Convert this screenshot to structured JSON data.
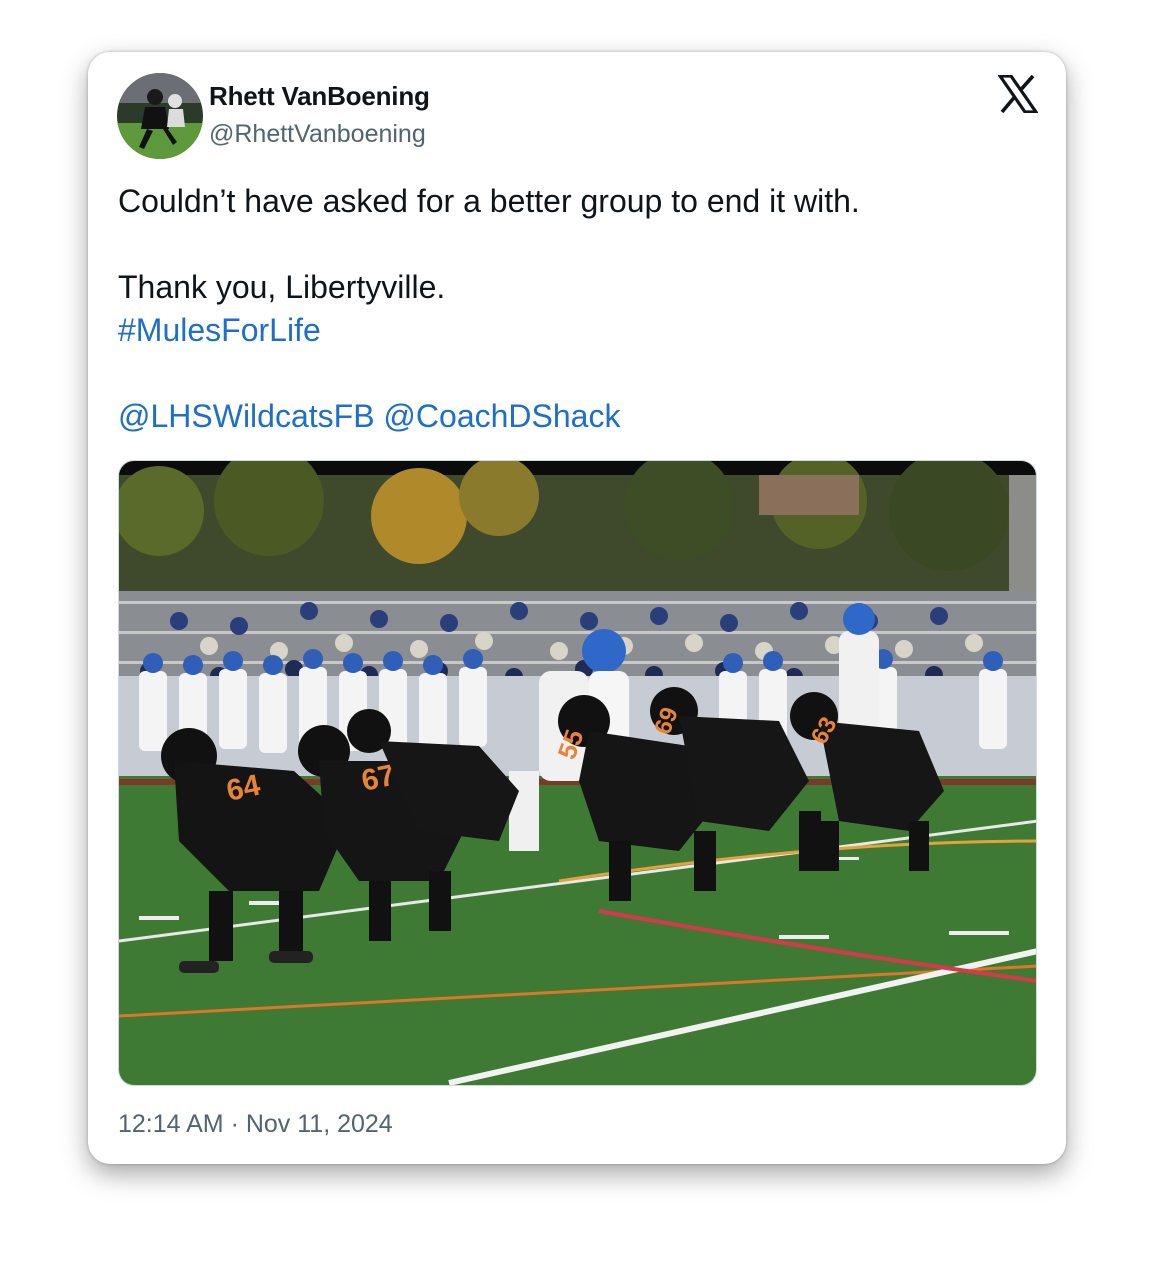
{
  "tweet": {
    "author": {
      "display_name": "Rhett VanBoening",
      "handle": "@RhettVanboening",
      "avatar_icon": "football-player-avatar"
    },
    "platform_icon": "x-logo-icon",
    "text": {
      "line1": "Couldn’t have asked for a better group to end it with.",
      "line2": "Thank you, Libertyville.",
      "hashtag": "#MulesForLife",
      "mention1": "@LHSWildcatsFB",
      "mention2": "@CoachDShack"
    },
    "timestamp": "12:14 AM · Nov 11, 2024",
    "colors": {
      "link": "#1d6fc7",
      "secondary_text": "#536471",
      "field_green": "#3f7a34",
      "jersey_orange": "#e8833a"
    },
    "image": {
      "jersey_numbers": [
        "64",
        "67",
        "55",
        "69",
        "63"
      ]
    }
  }
}
